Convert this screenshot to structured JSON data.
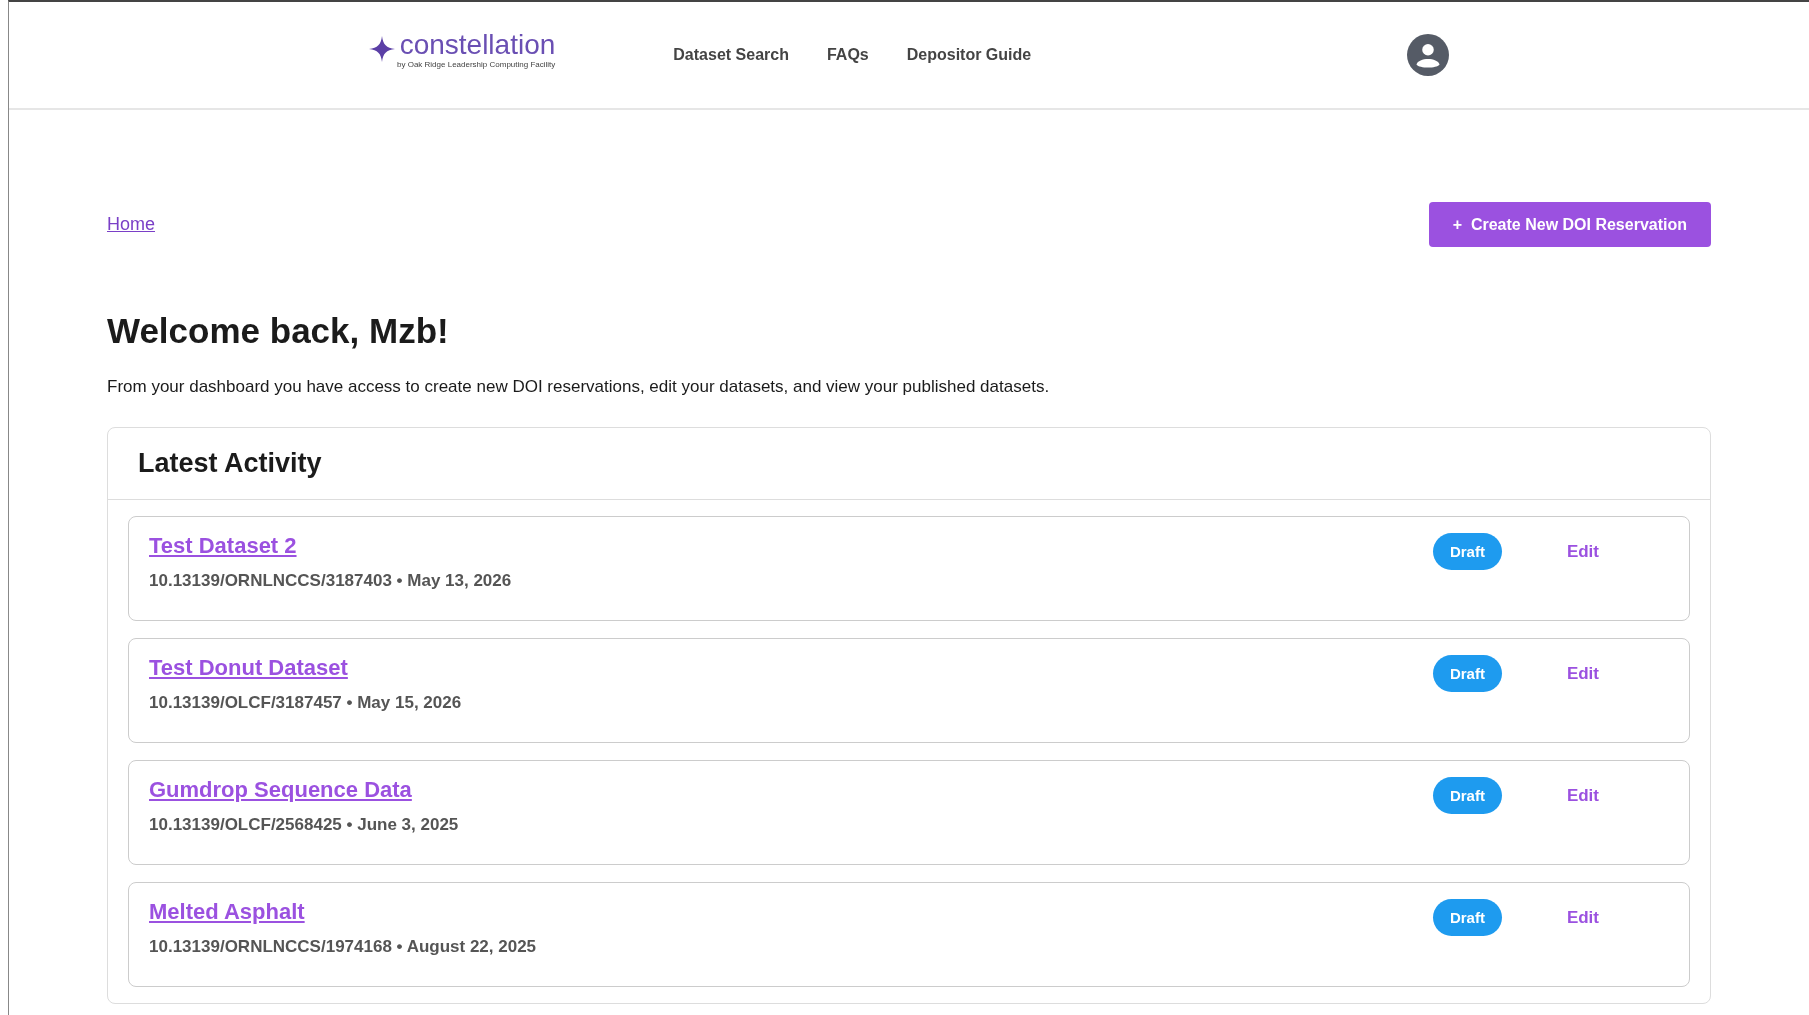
{
  "header": {
    "logo": {
      "name": "constellation",
      "tagline": "by Oak Ridge Leadership Computing Facility"
    },
    "nav": [
      "Dataset Search",
      "FAQs",
      "Depositor Guide"
    ]
  },
  "breadcrumb": [
    "Home"
  ],
  "create_button": {
    "icon": "+",
    "label": "Create New DOI Reservation"
  },
  "welcome": {
    "title": "Welcome back, Mzb!",
    "text": "From your dashboard you have access to create new DOI reservations, edit your datasets, and view your published datasets."
  },
  "activity": {
    "title": "Latest Activity",
    "items": [
      {
        "title": "Test Dataset 2",
        "doi": "10.13139/ORNLNCCS/3187403",
        "separator": "•",
        "date": "May 13, 2026",
        "status": "Draft",
        "action": "Edit"
      },
      {
        "title": "Test Donut Dataset",
        "doi": "10.13139/OLCF/3187457",
        "separator": "•",
        "date": "May 15, 2026",
        "status": "Draft",
        "action": "Edit"
      },
      {
        "title": "Gumdrop Sequence Data",
        "doi": "10.13139/OLCF/2568425",
        "separator": "•",
        "date": "June 3, 2025",
        "status": "Draft",
        "action": "Edit"
      },
      {
        "title": "Melted Asphalt",
        "doi": "10.13139/ORNLNCCS/1974168",
        "separator": "•",
        "date": "August 22, 2025",
        "status": "Draft",
        "action": "Edit"
      }
    ]
  }
}
